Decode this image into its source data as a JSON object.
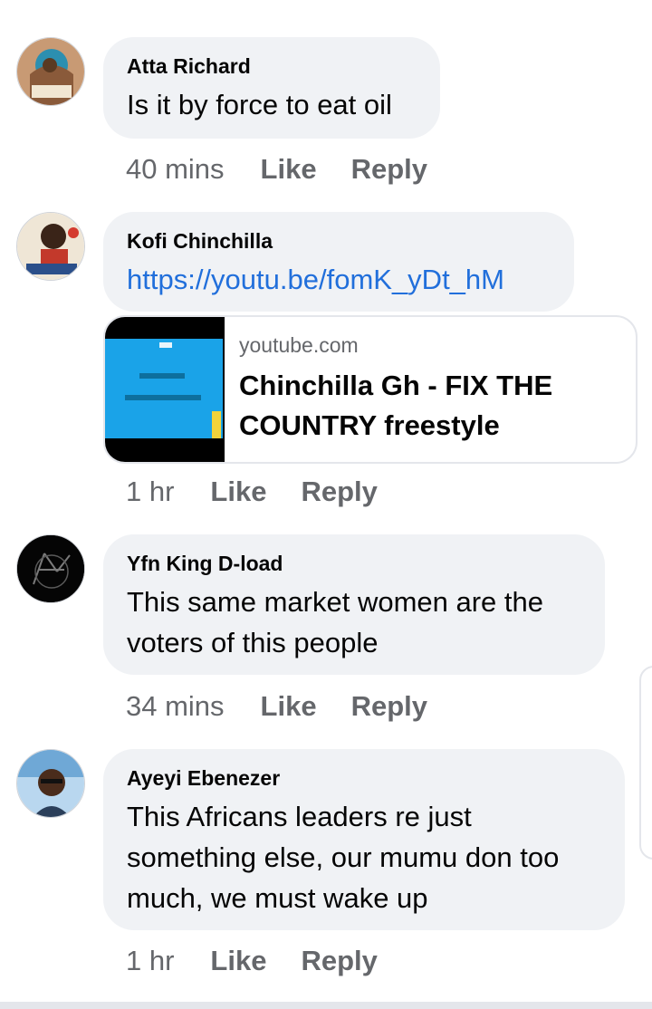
{
  "comments": [
    {
      "author": "Atta Richard",
      "text": "Is it by force to eat oil",
      "time": "40 mins",
      "like": "Like",
      "reply": "Reply"
    },
    {
      "author": "Kofi Chinchilla",
      "link": "https://youtu.be/fomK_yDt_hM",
      "preview": {
        "domain": "youtube.com",
        "title": "Chinchilla Gh - FIX THE COUNTRY freestyle"
      },
      "time": "1 hr",
      "like": "Like",
      "reply": "Reply"
    },
    {
      "author": "Yfn King D-load",
      "text": "This same market women are the voters of this people",
      "time": "34 mins",
      "like": "Like",
      "reply": "Reply"
    },
    {
      "author": "Ayeyi Ebenezer",
      "text": "This Africans leaders re just something else, our mumu don too much, we must wake up",
      "time": "1 hr",
      "like": "Like",
      "reply": "Reply"
    }
  ],
  "colors": {
    "bubble": "#f0f2f5",
    "link": "#216fdb",
    "meta": "#65676b"
  }
}
